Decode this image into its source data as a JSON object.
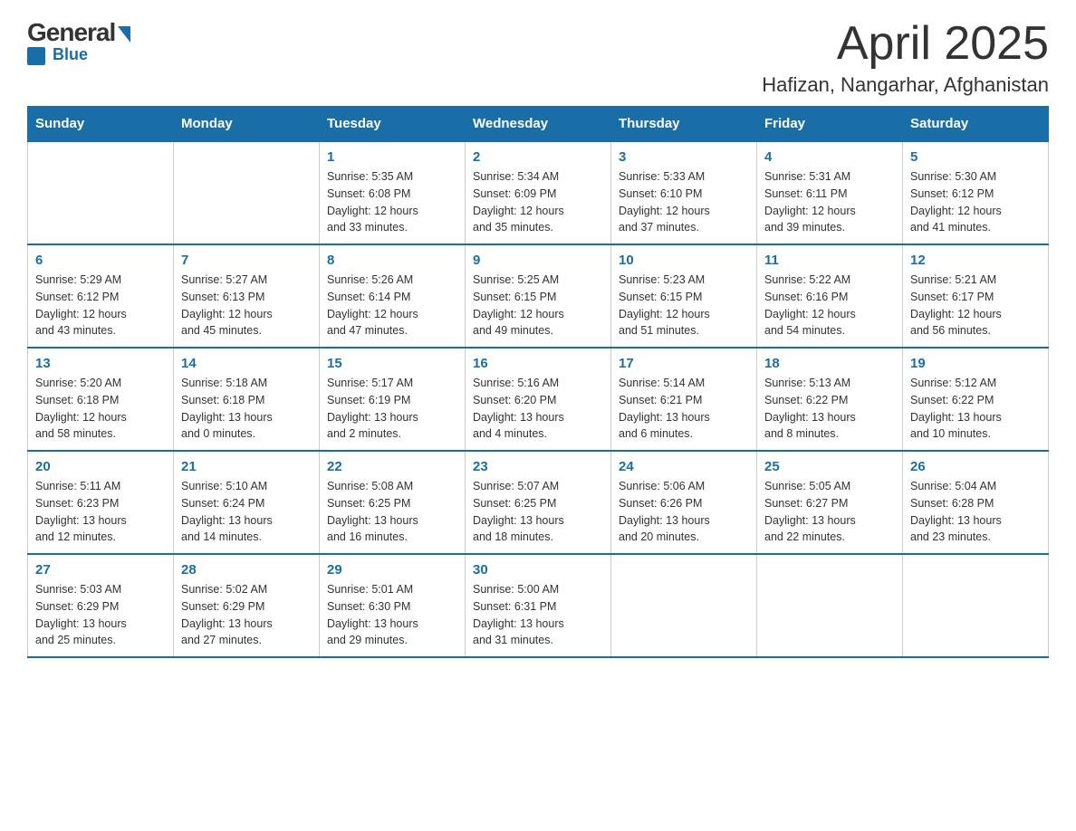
{
  "header": {
    "logo": {
      "general": "General",
      "blue": "Blue"
    },
    "title": "April 2025",
    "location": "Hafizan, Nangarhar, Afghanistan"
  },
  "calendar": {
    "days_of_week": [
      "Sunday",
      "Monday",
      "Tuesday",
      "Wednesday",
      "Thursday",
      "Friday",
      "Saturday"
    ],
    "weeks": [
      [
        {
          "day": "",
          "info": ""
        },
        {
          "day": "",
          "info": ""
        },
        {
          "day": "1",
          "info": "Sunrise: 5:35 AM\nSunset: 6:08 PM\nDaylight: 12 hours\nand 33 minutes."
        },
        {
          "day": "2",
          "info": "Sunrise: 5:34 AM\nSunset: 6:09 PM\nDaylight: 12 hours\nand 35 minutes."
        },
        {
          "day": "3",
          "info": "Sunrise: 5:33 AM\nSunset: 6:10 PM\nDaylight: 12 hours\nand 37 minutes."
        },
        {
          "day": "4",
          "info": "Sunrise: 5:31 AM\nSunset: 6:11 PM\nDaylight: 12 hours\nand 39 minutes."
        },
        {
          "day": "5",
          "info": "Sunrise: 5:30 AM\nSunset: 6:12 PM\nDaylight: 12 hours\nand 41 minutes."
        }
      ],
      [
        {
          "day": "6",
          "info": "Sunrise: 5:29 AM\nSunset: 6:12 PM\nDaylight: 12 hours\nand 43 minutes."
        },
        {
          "day": "7",
          "info": "Sunrise: 5:27 AM\nSunset: 6:13 PM\nDaylight: 12 hours\nand 45 minutes."
        },
        {
          "day": "8",
          "info": "Sunrise: 5:26 AM\nSunset: 6:14 PM\nDaylight: 12 hours\nand 47 minutes."
        },
        {
          "day": "9",
          "info": "Sunrise: 5:25 AM\nSunset: 6:15 PM\nDaylight: 12 hours\nand 49 minutes."
        },
        {
          "day": "10",
          "info": "Sunrise: 5:23 AM\nSunset: 6:15 PM\nDaylight: 12 hours\nand 51 minutes."
        },
        {
          "day": "11",
          "info": "Sunrise: 5:22 AM\nSunset: 6:16 PM\nDaylight: 12 hours\nand 54 minutes."
        },
        {
          "day": "12",
          "info": "Sunrise: 5:21 AM\nSunset: 6:17 PM\nDaylight: 12 hours\nand 56 minutes."
        }
      ],
      [
        {
          "day": "13",
          "info": "Sunrise: 5:20 AM\nSunset: 6:18 PM\nDaylight: 12 hours\nand 58 minutes."
        },
        {
          "day": "14",
          "info": "Sunrise: 5:18 AM\nSunset: 6:18 PM\nDaylight: 13 hours\nand 0 minutes."
        },
        {
          "day": "15",
          "info": "Sunrise: 5:17 AM\nSunset: 6:19 PM\nDaylight: 13 hours\nand 2 minutes."
        },
        {
          "day": "16",
          "info": "Sunrise: 5:16 AM\nSunset: 6:20 PM\nDaylight: 13 hours\nand 4 minutes."
        },
        {
          "day": "17",
          "info": "Sunrise: 5:14 AM\nSunset: 6:21 PM\nDaylight: 13 hours\nand 6 minutes."
        },
        {
          "day": "18",
          "info": "Sunrise: 5:13 AM\nSunset: 6:22 PM\nDaylight: 13 hours\nand 8 minutes."
        },
        {
          "day": "19",
          "info": "Sunrise: 5:12 AM\nSunset: 6:22 PM\nDaylight: 13 hours\nand 10 minutes."
        }
      ],
      [
        {
          "day": "20",
          "info": "Sunrise: 5:11 AM\nSunset: 6:23 PM\nDaylight: 13 hours\nand 12 minutes."
        },
        {
          "day": "21",
          "info": "Sunrise: 5:10 AM\nSunset: 6:24 PM\nDaylight: 13 hours\nand 14 minutes."
        },
        {
          "day": "22",
          "info": "Sunrise: 5:08 AM\nSunset: 6:25 PM\nDaylight: 13 hours\nand 16 minutes."
        },
        {
          "day": "23",
          "info": "Sunrise: 5:07 AM\nSunset: 6:25 PM\nDaylight: 13 hours\nand 18 minutes."
        },
        {
          "day": "24",
          "info": "Sunrise: 5:06 AM\nSunset: 6:26 PM\nDaylight: 13 hours\nand 20 minutes."
        },
        {
          "day": "25",
          "info": "Sunrise: 5:05 AM\nSunset: 6:27 PM\nDaylight: 13 hours\nand 22 minutes."
        },
        {
          "day": "26",
          "info": "Sunrise: 5:04 AM\nSunset: 6:28 PM\nDaylight: 13 hours\nand 23 minutes."
        }
      ],
      [
        {
          "day": "27",
          "info": "Sunrise: 5:03 AM\nSunset: 6:29 PM\nDaylight: 13 hours\nand 25 minutes."
        },
        {
          "day": "28",
          "info": "Sunrise: 5:02 AM\nSunset: 6:29 PM\nDaylight: 13 hours\nand 27 minutes."
        },
        {
          "day": "29",
          "info": "Sunrise: 5:01 AM\nSunset: 6:30 PM\nDaylight: 13 hours\nand 29 minutes."
        },
        {
          "day": "30",
          "info": "Sunrise: 5:00 AM\nSunset: 6:31 PM\nDaylight: 13 hours\nand 31 minutes."
        },
        {
          "day": "",
          "info": ""
        },
        {
          "day": "",
          "info": ""
        },
        {
          "day": "",
          "info": ""
        }
      ]
    ]
  }
}
